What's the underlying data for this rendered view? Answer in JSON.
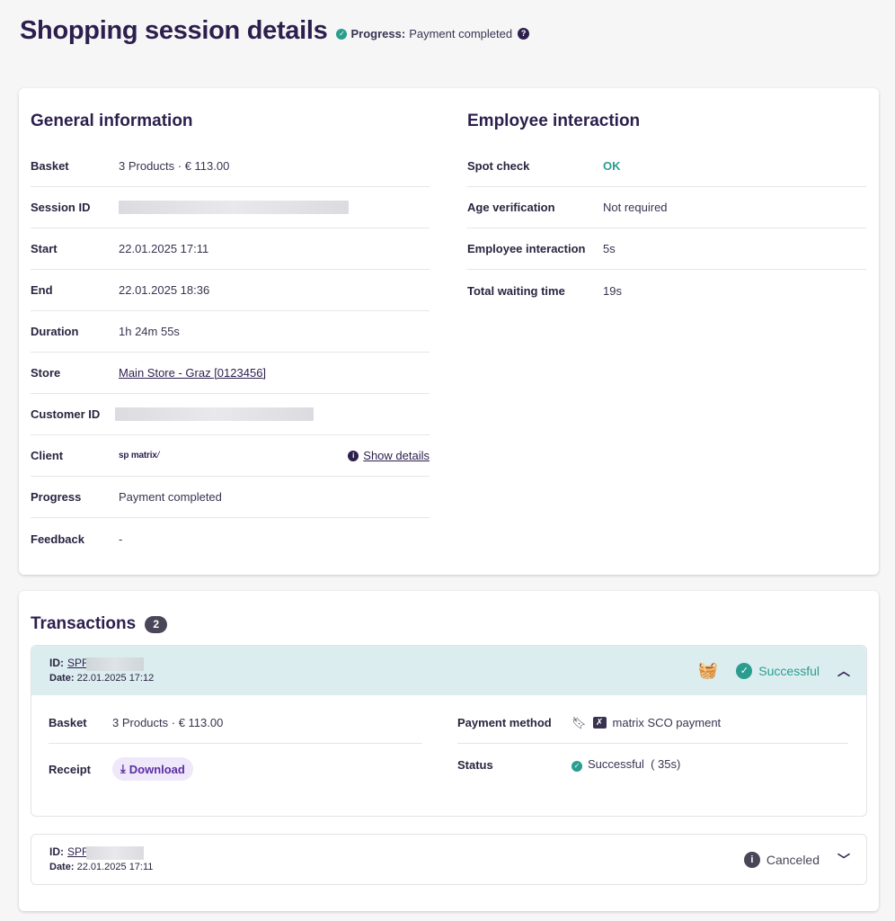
{
  "header": {
    "title": "Shopping session details",
    "progress_label": "Progress:",
    "progress_value": "Payment completed"
  },
  "general": {
    "title": "General information",
    "rows": [
      {
        "label": "Basket",
        "value": "3 Products · € 113.00"
      },
      {
        "label": "Session ID",
        "value": ""
      },
      {
        "label": "Start",
        "value": "22.01.2025 17:11"
      },
      {
        "label": "End",
        "value": "22.01.2025 18:36"
      },
      {
        "label": "Duration",
        "value": "1h 24m 55s"
      },
      {
        "label": "Store",
        "value": "Main Store - Graz [0123456]"
      },
      {
        "label": "Customer ID",
        "value": ""
      },
      {
        "label": "Client",
        "value": "sp matrix",
        "action": "Show details"
      },
      {
        "label": "Progress",
        "value": "Payment completed"
      },
      {
        "label": "Feedback",
        "value": "-"
      }
    ]
  },
  "employee": {
    "title": "Employee interaction",
    "rows": [
      {
        "label": "Spot check",
        "value": "OK"
      },
      {
        "label": "Age verification",
        "value": "Not required"
      },
      {
        "label": "Employee interaction",
        "value": "5s"
      },
      {
        "label": "Total waiting time",
        "value": "19s"
      }
    ]
  },
  "transactions": {
    "title": "Transactions",
    "count": "2",
    "items": [
      {
        "id_label": "ID:",
        "id_prefix": "SPF",
        "date_label": "Date:",
        "date": "22.01.2025 17:12",
        "status": "Successful",
        "basket_label": "Basket",
        "basket_value": "3 Products · € 113.00",
        "receipt_label": "Receipt",
        "download_label": "Download",
        "payment_label": "Payment method",
        "payment_value": "matrix SCO payment",
        "status_label": "Status",
        "status_value": "Successful",
        "status_duration": "( 35s)"
      },
      {
        "id_label": "ID:",
        "id_prefix": "SPF",
        "date_label": "Date:",
        "date": "22.01.2025 17:11",
        "status": "Canceled"
      }
    ]
  },
  "colors": {
    "accent": "#2a9d8f",
    "title": "#2c1f4d",
    "expanded_header_bg": "#dcedf0",
    "download_bg": "#efe7fa"
  }
}
